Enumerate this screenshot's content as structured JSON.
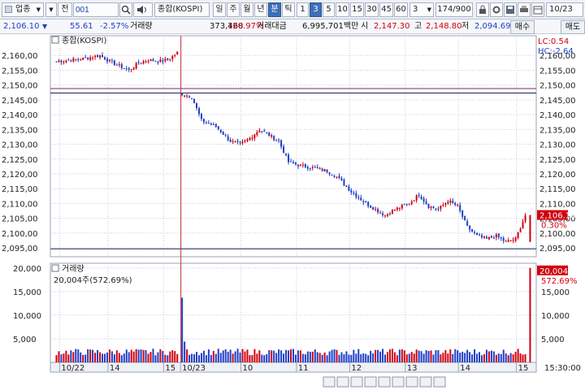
{
  "toolbar": {
    "market_select": "업종",
    "market_arrow": "▼",
    "market_type": "전",
    "code_value": "001",
    "search_icon": "search-icon",
    "sound_icon": "speaker-icon",
    "index_name": "종합(KOSPI)",
    "periods": [
      "일",
      "주",
      "월",
      "년",
      "분",
      "틱"
    ],
    "selected_period": "분",
    "minutes": [
      "1",
      "3",
      "5",
      "10",
      "15",
      "30",
      "45",
      "60"
    ],
    "selected_minute": "3",
    "interval_value": "3",
    "count_display": "174/900",
    "date_value": "10/23"
  },
  "infobar": {
    "price": "2,106.10",
    "arrow": "▼",
    "change": "55.61",
    "change_pct": "-2.57%",
    "volume_label": "거래량",
    "volume": "373,468",
    "volume_ratio": "120.97%",
    "amount_label": "거래대금",
    "amount": "6,995,701백만",
    "open_label": "시",
    "open": "2,147.30",
    "high_label": "고",
    "high": "2,148.80",
    "low_label": "저",
    "low": "2,094.69",
    "buy_label": "매수",
    "sell_label": "매도"
  },
  "chart_data": {
    "type": "candlestick",
    "price_title": "종합(KOSPI)",
    "volume_title": "거래량",
    "volume_info": "20,004주(572.69%)",
    "lc_label": "LC:0.54",
    "hc_label": "HC:-2.64",
    "last_price_label": "2,106.10",
    "last_pct_label": "0.30%",
    "last_volume_label": "20,004",
    "last_volume_pct_label": "572.69%",
    "price_ylim": [
      2092,
      2165
    ],
    "price_ticks": [
      "2,160,00",
      "2,155,00",
      "2,150,00",
      "2,145,00",
      "2,140,00",
      "2,135,00",
      "2,130,00",
      "2,125,00",
      "2,120,00",
      "2,115,00",
      "2,110,00",
      "2,105,00",
      "2,100,00",
      "2,095,00"
    ],
    "price_tick_values": [
      2160,
      2155,
      2150,
      2145,
      2140,
      2135,
      2130,
      2125,
      2120,
      2115,
      2110,
      2105,
      2100,
      2095
    ],
    "right_ticks": [
      "2,160,00",
      "2,155,00",
      "2,150,00",
      "2,145,00",
      "2,140,00",
      "2,135,00",
      "2,130,00",
      "2,125,00",
      "2,120,00",
      "2,115,00",
      "2,110,00",
      "2,105,00",
      "2,100,00",
      "2,095,00"
    ],
    "volume_ylim": [
      0,
      21000
    ],
    "volume_ticks": [
      "20,000",
      "15,000",
      "10,000",
      "5,000"
    ],
    "volume_tick_values": [
      20000,
      15000,
      10000,
      5000
    ],
    "right_volume_ticks": [
      "15,000",
      "10,000",
      "5,000"
    ],
    "right_volume_tick_values": [
      15000,
      10000,
      5000
    ],
    "x_labels": [
      "10/22",
      "14",
      "15",
      "10/23",
      "10",
      "11",
      "12",
      "13",
      "14",
      "15"
    ],
    "x_label_positions": [
      2,
      22,
      45,
      52,
      77,
      100,
      122,
      145,
      167,
      191
    ],
    "time_label": "15:30:00",
    "ref_lines": [
      2147.3,
      2148.8,
      2094.69
    ],
    "day_divider_index": 52,
    "candles_count": 205
  },
  "bottom_controls": {
    "icons": [
      "zoom-in-icon",
      "zoom-out-icon",
      "stop-icon",
      "rewind-icon",
      "play-icon",
      "next-icon",
      "settings-icon",
      "expand-icon",
      "zoom-icon"
    ]
  },
  "colors": {
    "up": "#d2000f",
    "down": "#1f3fc7",
    "grid": "#c9ced8",
    "divider": "#c8303c"
  }
}
